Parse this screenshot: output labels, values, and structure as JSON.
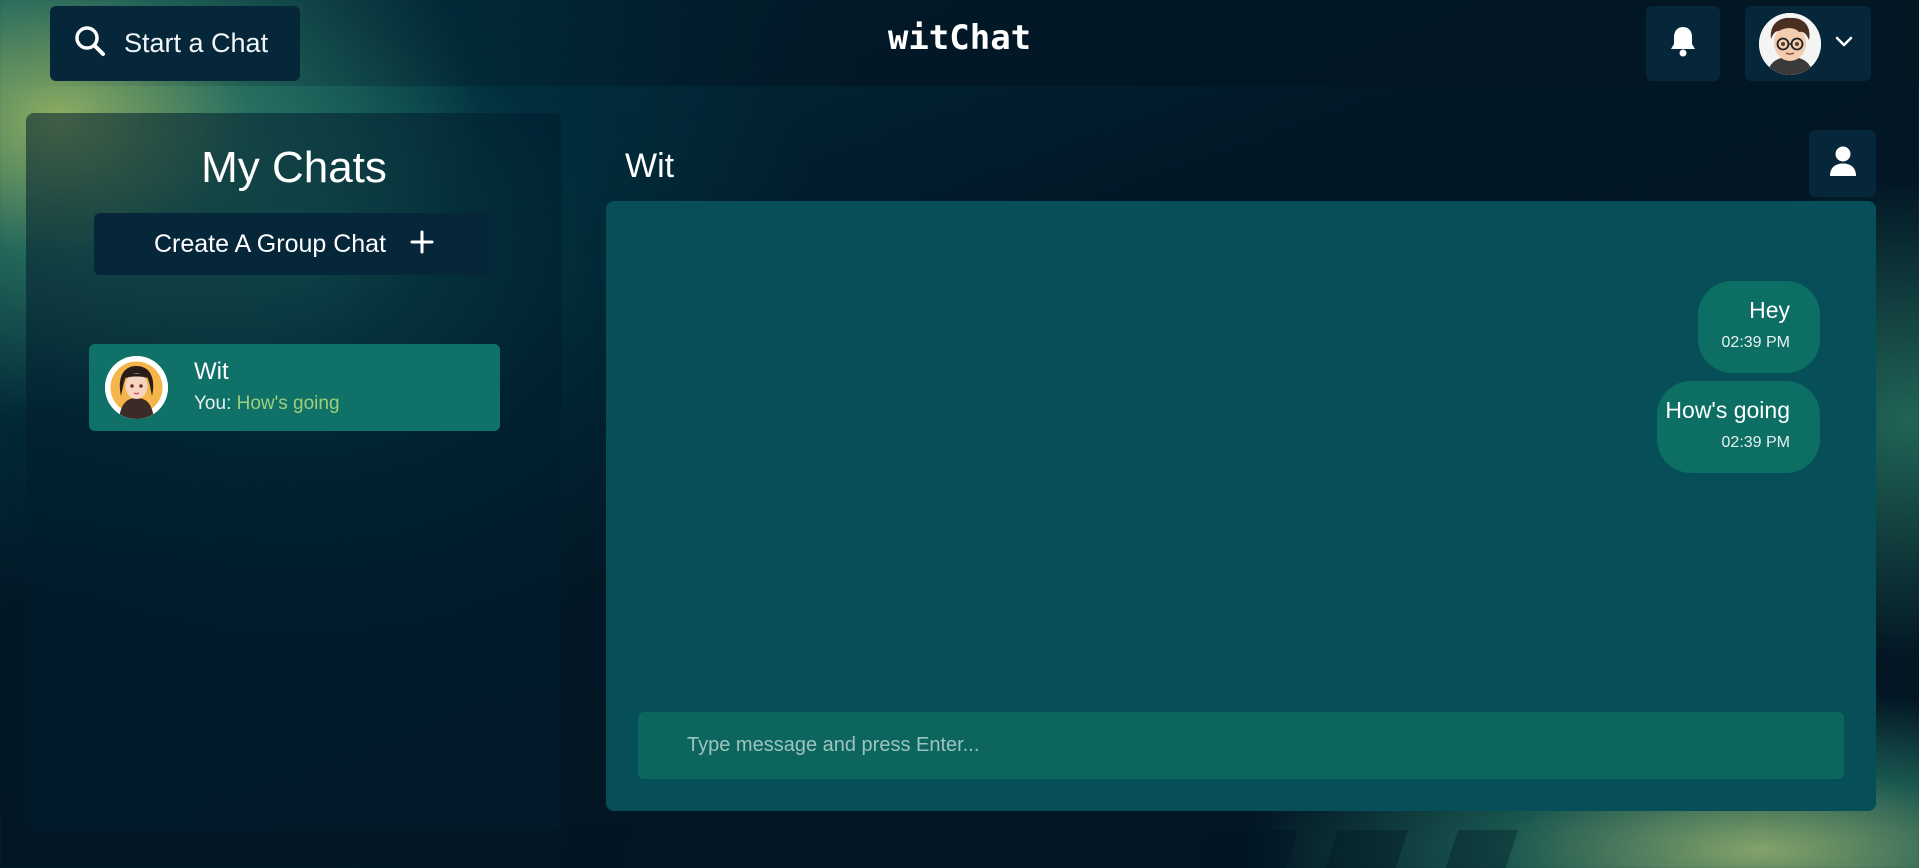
{
  "app": {
    "brand": "witChat"
  },
  "header": {
    "search_label": "Start a Chat",
    "search_icon": "search-icon",
    "notifications_icon": "bell-icon",
    "profile_menu_icon": "chevron-down-icon"
  },
  "sidebar": {
    "title": "My Chats",
    "create_group_label": "Create A Group Chat",
    "create_group_icon": "plus-icon",
    "chats": [
      {
        "name": "Wit",
        "preview_prefix": "You:",
        "preview_text": "How's going",
        "selected": true
      }
    ]
  },
  "conversation": {
    "title": "Wit",
    "contact_icon": "user-icon",
    "messages": [
      {
        "text": "Hey",
        "time": "02:39 PM",
        "sender": "me"
      },
      {
        "text": "How's going",
        "time": "02:39 PM",
        "sender": "me"
      }
    ],
    "input_placeholder": "Type message and press Enter..."
  },
  "colors": {
    "accent": "#0f7168",
    "panel": "#064e58",
    "dark_button": "#062639",
    "preview_highlight": "#9fcf7c"
  }
}
